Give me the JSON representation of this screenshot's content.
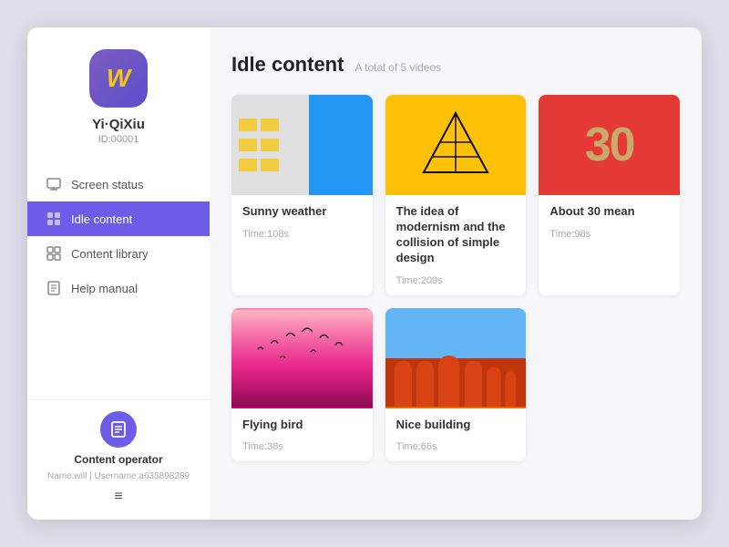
{
  "sidebar": {
    "app_name": "Yi·QiXiu",
    "user_id": "ID:00001",
    "avatar_letter": "W",
    "nav_items": [
      {
        "id": "screen-status",
        "label": "Screen status",
        "active": false
      },
      {
        "id": "idle-content",
        "label": "Idle content",
        "active": true
      },
      {
        "id": "content-library",
        "label": "Content library",
        "active": false
      },
      {
        "id": "help-manual",
        "label": "Help manual",
        "active": false
      }
    ],
    "operator_label": "Content operator",
    "operator_name": "Name:will",
    "operator_username": "Username:a635898289"
  },
  "main": {
    "page_title": "Idle content",
    "page_subtitle": "A total of 5 videos",
    "videos": [
      {
        "id": "sunny-weather",
        "title": "Sunny weather",
        "time": "Time:108s",
        "thumb_type": "sunny"
      },
      {
        "id": "modernism",
        "title": "The idea of modernism and the collision of simple design",
        "time": "Time:209s",
        "thumb_type": "modern"
      },
      {
        "id": "about-30",
        "title": "About 30 mean",
        "time": "Time:98s",
        "thumb_type": "thirty"
      },
      {
        "id": "flying-bird",
        "title": "Flying bird",
        "time": "Time:38s",
        "thumb_type": "bird"
      },
      {
        "id": "nice-building",
        "title": "Nice building",
        "time": "Time:66s",
        "thumb_type": "building"
      }
    ]
  },
  "icons": {
    "screen": "▣",
    "idle": "⊞",
    "library": "⊡",
    "help": "⊟",
    "menu": "≡"
  }
}
